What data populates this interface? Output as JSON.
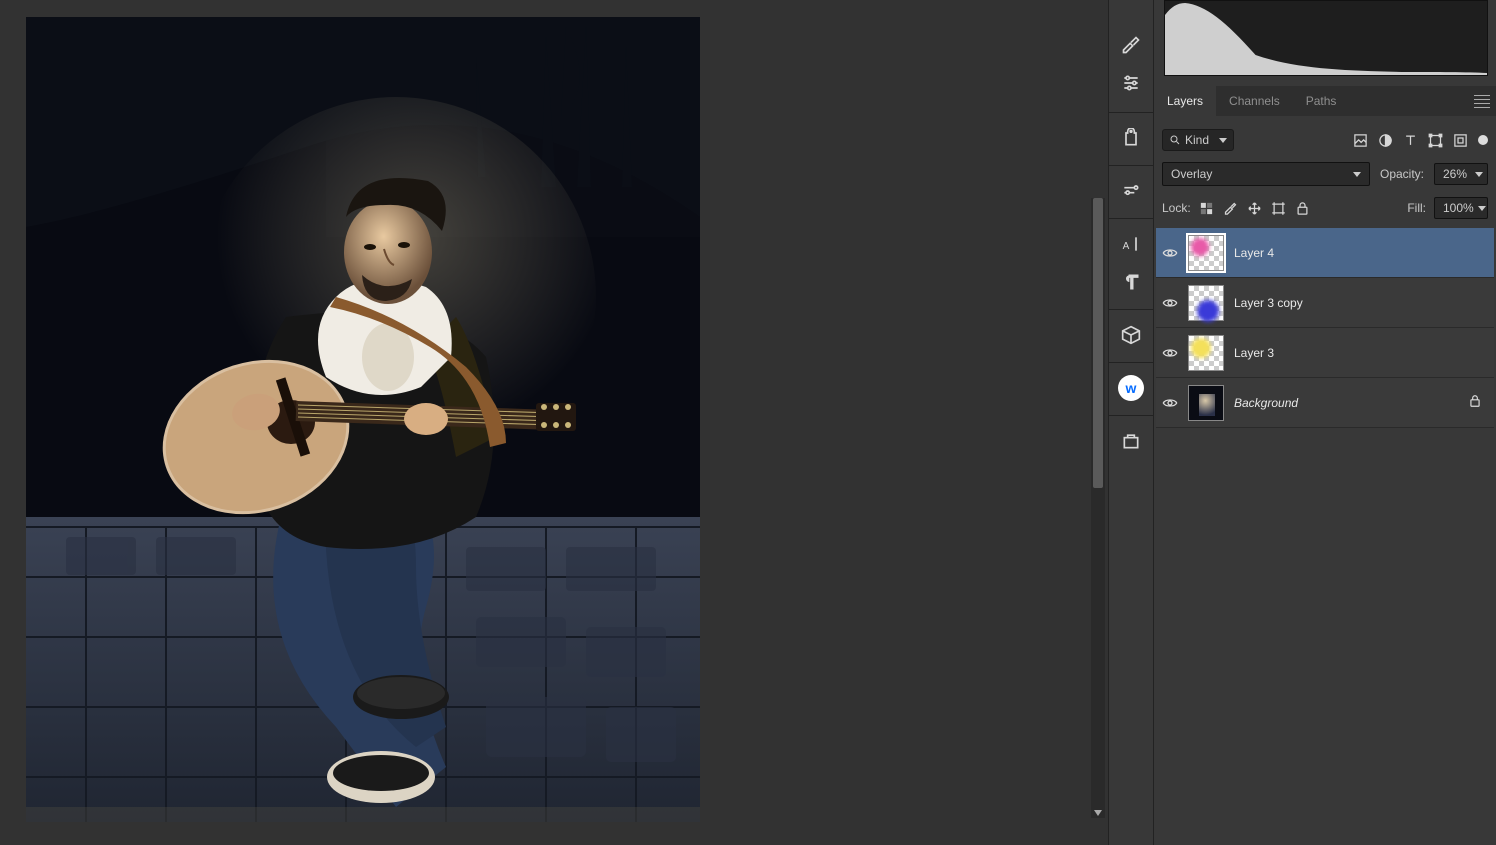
{
  "panels": {
    "tabs": [
      "Layers",
      "Channels",
      "Paths"
    ],
    "activeTab": 0
  },
  "filterRow": {
    "kindLabel": "Kind"
  },
  "blendRow": {
    "mode": "Overlay",
    "opacityLabel": "Opacity:",
    "opacityValue": "26%"
  },
  "lockRow": {
    "lockLabel": "Lock:",
    "fillLabel": "Fill:",
    "fillValue": "100%"
  },
  "layers": [
    {
      "name": "Layer 4",
      "selected": true,
      "locked": false,
      "thumb": "pink"
    },
    {
      "name": "Layer 3 copy",
      "selected": false,
      "locked": false,
      "thumb": "blue"
    },
    {
      "name": "Layer 3",
      "selected": false,
      "locked": false,
      "thumb": "yellow"
    },
    {
      "name": "Background",
      "selected": false,
      "locked": true,
      "thumb": "dark"
    }
  ]
}
